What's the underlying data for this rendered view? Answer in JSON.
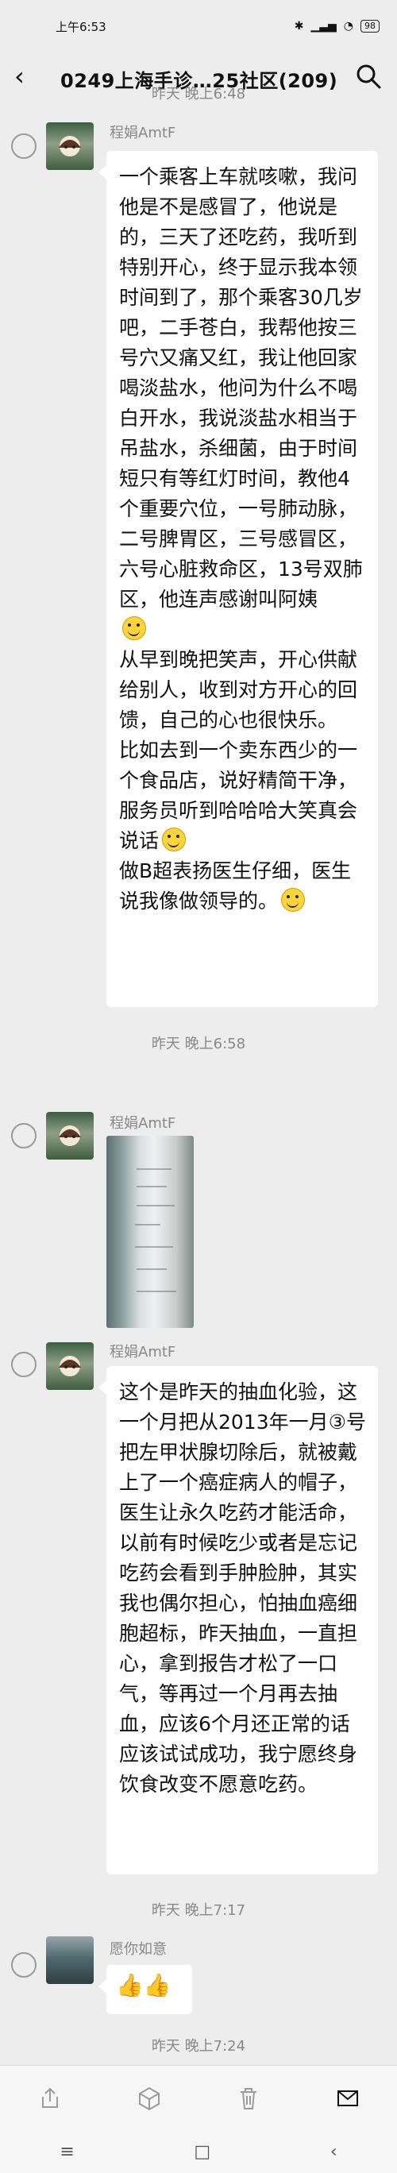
{
  "status": {
    "time": "上午6:53",
    "battery": "98"
  },
  "header": {
    "title": "0249上海手诊…25社区(209)"
  },
  "timeline": {
    "top": "昨天 晚上6:48",
    "t1": "昨天 晚上6:58",
    "t2": "昨天 晚上7:17",
    "t3": "昨天 晚上7:24"
  },
  "messages": [
    {
      "sender": "程娟AmtF",
      "text": "一个乘客上车就咳嗽，我问他是不是感冒了，他说是的，三天了还吃药，我听到特别开心，终于显示我本领时间到了，那个乘客30几岁吧，二手苍白，我帮他按三号穴又痛又红，我让他回家喝淡盐水，他问为什么不喝白开水，我说淡盐水相当于吊盐水，杀细菌，由于时间短只有等红灯时间，教他4个重要穴位，一号肺动脉，二号脾胃区，三号感冒区，六号心脏救命区，13号双肺区，他连声感谢叫阿姨",
      "text2": "从早到晚把笑声，开心供献给别人，收到对方开心的回馈，自己的心也很快乐。",
      "text3": "比如去到一个卖东西少的一个食品店，说好精简干净，服务员听到哈哈哈大笑真会说话",
      "text4": "做B超表扬医生仔细，医生说我像做领导的。"
    },
    {
      "sender": "程娟AmtF",
      "type": "image"
    },
    {
      "sender": "程娟AmtF",
      "text": "这个是昨天的抽血化验，这一个月把从2013年一月③号把左甲状腺切除后，就被戴上了一个癌症病人的帽子，医生让永久吃药才能活命，以前有时候吃少或者是忘记吃药会看到手肿脸肿，其实我也偶尔担心，怕抽血癌细胞超标，昨天抽血，一直担心，拿到报告才松了一口气，等再过一个月再去抽血，应该6个月还正常的话应该试试成功，我宁愿终身饮食改变不愿意吃药。"
    },
    {
      "sender": "愿你如意",
      "text": "👍👍"
    }
  ],
  "toolbar": [
    "share-icon",
    "favorite-icon",
    "delete-icon",
    "mail-icon"
  ],
  "system_nav": [
    "≡",
    "□",
    "‹"
  ]
}
